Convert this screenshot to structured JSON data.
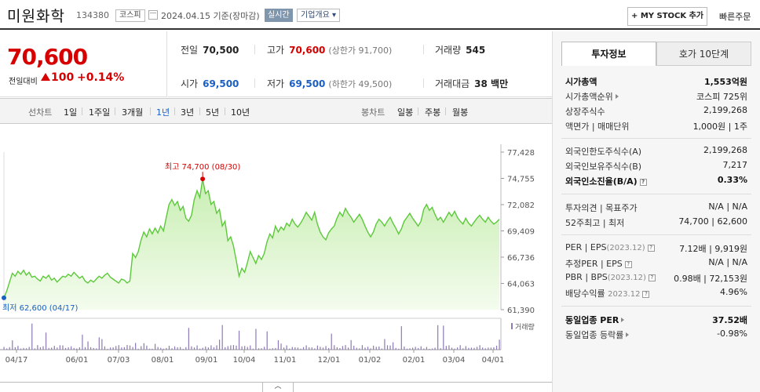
{
  "header": {
    "name": "미원화학",
    "code": "134380",
    "market": "코스피",
    "date": "2024.04.15 기준(장마감)",
    "realtime": "실시간",
    "overview": "기업개요 ▾",
    "mystock": "+ MY STOCK 추가",
    "quick_order": "빠른주문"
  },
  "price": {
    "current": "70,600",
    "change_label": "전일대비",
    "change": "100",
    "change_rate": "+0.14%"
  },
  "quote": {
    "prev_label": "전일",
    "prev": "70,500",
    "high_label": "고가",
    "high": "70,600",
    "upper_limit": "(상한가 91,700)",
    "volume_label": "거래량",
    "volume": "545",
    "open_label": "시가",
    "open": "69,500",
    "low_label": "저가",
    "low": "69,500",
    "lower_limit": "(하한가 49,500)",
    "amount_label": "거래대금",
    "amount": "38 백만"
  },
  "periods": {
    "line_label": "선차트",
    "line_items": [
      "1일",
      "1주일",
      "3개월",
      "1년",
      "3년",
      "5년",
      "10년"
    ],
    "active_index": 3,
    "candle_label": "봉차트",
    "candle_items": [
      "일봉",
      "주봉",
      "월봉"
    ]
  },
  "side": {
    "tab_info": "투자정보",
    "tab_orderbook": "호가 10단계",
    "market_cap_label": "시가총액",
    "market_cap": "1,553억원",
    "cap_rank_label": "시가총액순위",
    "cap_rank": "코스피 725위",
    "shares_label": "상장주식수",
    "shares": "2,199,268",
    "par_label": "액면가 | 매매단위",
    "par": "1,000원 | 1주",
    "foreign_limit_label": "외국인한도주식수(A)",
    "foreign_limit": "2,199,268",
    "foreign_hold_label": "외국인보유주식수(B)",
    "foreign_hold": "7,217",
    "foreign_ratio_label": "외국인소진율(B/A)",
    "foreign_ratio": "0.33%",
    "opinion_label": "투자의견 | 목표주가",
    "opinion": "N/A | N/A",
    "w52_label": "52주최고 | 최저",
    "w52": "74,700 | 62,600",
    "per_label": "PER | EPS",
    "per_year": "(2023.12)",
    "per": "7.12배 | 9,919원",
    "est_per_label": "추정PER | EPS",
    "est_per": "N/A | N/A",
    "pbr_label": "PBR | BPS",
    "pbr_year": "(2023.12)",
    "pbr": "0.98배 | 72,153원",
    "div_label": "배당수익률",
    "div_year": "2023.12",
    "div": "4.96%",
    "ind_per_label": "동일업종 PER",
    "ind_per": "37.52배",
    "ind_rate_label": "동일업종 등락률",
    "ind_rate": "-0.98%"
  },
  "colors": {
    "up": "#d60000",
    "down": "#1a5fc4",
    "line": "#5cc93a",
    "fill_top": "#c8eeb2",
    "fill_bottom": "#f4fcee"
  },
  "chart_data": {
    "type": "area",
    "ylim": [
      61390,
      77428
    ],
    "y_ticks": [
      "77,428",
      "74,755",
      "72,082",
      "69,409",
      "66,736",
      "64,063",
      "61,390"
    ],
    "x_ticks": [
      "04/17",
      "06/01",
      "07/03",
      "08/01",
      "09/01",
      "10/04",
      "11/01",
      "12/01",
      "01/02",
      "02/01",
      "03/04",
      "04/01"
    ],
    "values": [
      62600,
      63300,
      64200,
      65100,
      64800,
      65300,
      65000,
      65400,
      64900,
      65200,
      64700,
      64800,
      64500,
      64300,
      64800,
      64600,
      64900,
      64400,
      64600,
      64200,
      64500,
      64800,
      64700,
      65000,
      64800,
      65200,
      64900,
      64600,
      64800,
      64300,
      64100,
      64400,
      64200,
      64500,
      64800,
      64600,
      64900,
      65100,
      64700,
      64500,
      64300,
      64100,
      64500,
      64400,
      64100,
      64300,
      67100,
      66700,
      67300,
      68500,
      69300,
      68800,
      69600,
      69100,
      69700,
      69200,
      69900,
      69400,
      70800,
      72100,
      72600,
      72000,
      72400,
      71500,
      71900,
      70700,
      70400,
      71000,
      72600,
      73500,
      72800,
      74700,
      73200,
      73500,
      72100,
      72400,
      71200,
      71600,
      69900,
      70400,
      68400,
      68800,
      67900,
      66400,
      64800,
      65600,
      65200,
      66200,
      67300,
      66700,
      66100,
      66900,
      66500,
      67100,
      68300,
      69100,
      68700,
      69900,
      69300,
      69800,
      69500,
      70200,
      69900,
      70600,
      70100,
      69800,
      70200,
      70700,
      71300,
      70900,
      70500,
      71300,
      70100,
      69300,
      68800,
      68500,
      69200,
      69600,
      69900,
      70700,
      71300,
      70900,
      71700,
      71200,
      70800,
      70300,
      70700,
      71100,
      70600,
      69900,
      69300,
      68800,
      69300,
      70100,
      70600,
      70300,
      69900,
      70400,
      70800,
      70200,
      69700,
      69100,
      69600,
      70400,
      70800,
      71200,
      70700,
      70300,
      69900,
      70400,
      71600,
      72100,
      71500,
      71800,
      71100,
      70500,
      70800,
      70300,
      70800,
      71300,
      70900,
      71400,
      70800,
      70400,
      70100,
      70700,
      70200,
      69900,
      70300,
      70700,
      71000,
      70600,
      70300,
      70800,
      70400,
      70100,
      70300,
      70600
    ],
    "max_label": "최고 74,700 (08/30)",
    "min_label": "최저 62,600 (04/17)",
    "volume_legend": "거래량"
  },
  "footer": {
    "toggle": "︿"
  }
}
